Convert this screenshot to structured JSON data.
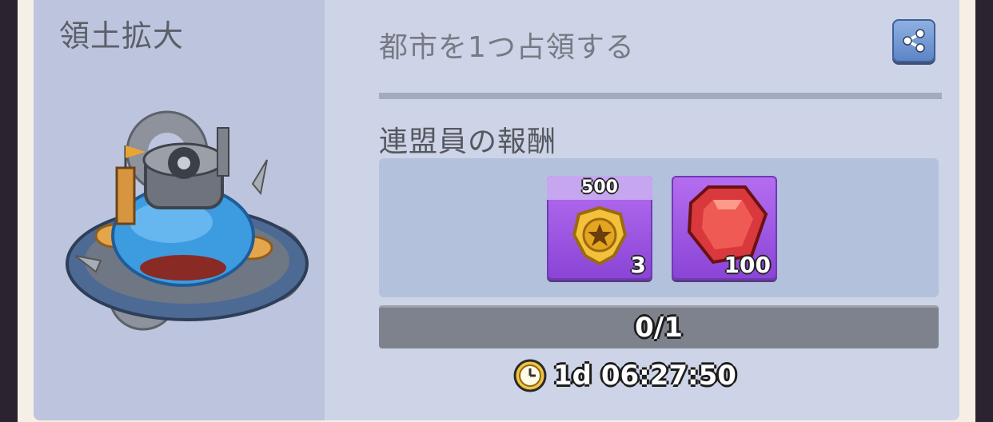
{
  "mission": {
    "title": "領土拡大",
    "objective": "都市を1つ占領する"
  },
  "share": {
    "icon": "share-icon"
  },
  "rewards": {
    "section_title": "連盟員の報酬",
    "items": [
      {
        "icon": "medal-icon",
        "top_label": "500",
        "count": "3"
      },
      {
        "icon": "gem-icon",
        "count": "100"
      }
    ]
  },
  "progress": {
    "text": "0/1",
    "fraction": 0
  },
  "timer": {
    "icon": "clock-icon",
    "text": "1d 06:27:50"
  },
  "colors": {
    "card_bg": "#cdd4e7",
    "left_panel_bg": "#bcc5dd",
    "reward_box_bg": "#b4c1dd",
    "item_bg": "#9a52e0",
    "progress_bg": "#7e828c",
    "share_button": "#6f95d4"
  }
}
